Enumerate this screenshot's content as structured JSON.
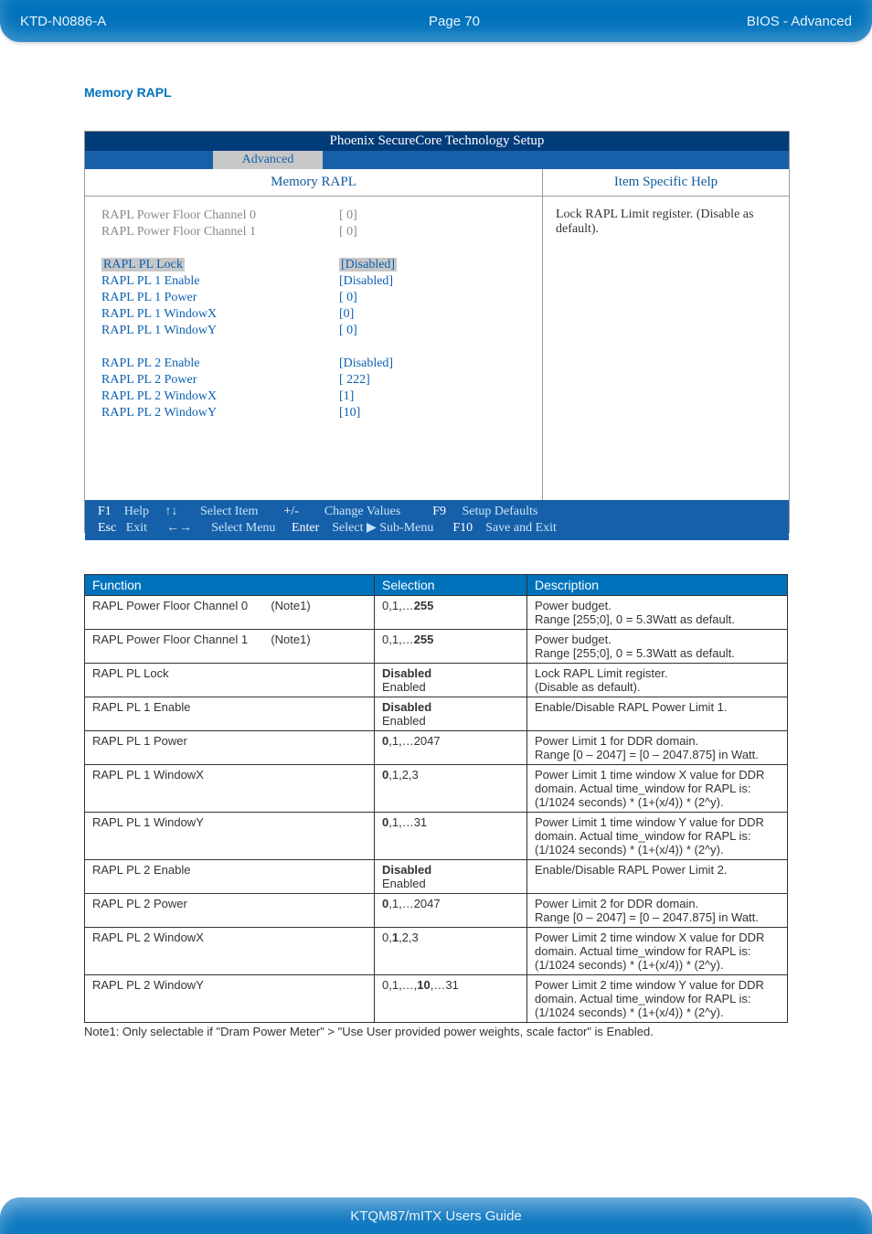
{
  "header": {
    "doc_id": "KTD-N0886-A",
    "page": "Page 70",
    "section": "BIOS  - Advanced"
  },
  "section_title": "Memory RAPL",
  "bios": {
    "title": "Phoenix SecureCore Technology Setup",
    "tab": "Advanced",
    "left_title": "Memory RAPL",
    "right_title": "Item Specific Help",
    "items": [
      {
        "label": "RAPL Power Floor Channel 0",
        "value": "[    0]",
        "dim": true
      },
      {
        "label": "RAPL Power Floor Channel 1",
        "value": "[    0]",
        "dim": true
      },
      {
        "spacer": true
      },
      {
        "label": "RAPL PL Lock",
        "value": "[Disabled]",
        "sel": true
      },
      {
        "label": "RAPL PL 1 Enable",
        "value": "[Disabled]"
      },
      {
        "label": "RAPL PL 1 Power",
        "value": "[    0]"
      },
      {
        "label": "RAPL PL 1 WindowX",
        "value": "[0]"
      },
      {
        "label": "RAPL PL 1 WindowY",
        "value": "[  0]"
      },
      {
        "spacer": true
      },
      {
        "label": "RAPL PL 2 Enable",
        "value": "[Disabled]"
      },
      {
        "label": "RAPL PL 2 Power",
        "value": "[  222]"
      },
      {
        "label": "RAPL PL 2 WindowX",
        "value": "[1]"
      },
      {
        "label": "RAPL PL 2 WindowY",
        "value": "[10]"
      }
    ],
    "help_text": "Lock RAPL Limit register. (Disable as default).",
    "footer": {
      "f1": "F1",
      "help": "Help",
      "ud": "↑↓",
      "si": "Select Item",
      "pm": "+/-",
      "cv": "Change Values",
      "f9": "F9",
      "sd": "Setup Defaults",
      "esc": "Esc",
      "exit": "Exit",
      "lr": "←→",
      "sm": "Select Menu",
      "enter": "Enter",
      "ssm": "Select ▶ Sub-Menu",
      "f10": "F10",
      "se": "Save and Exit"
    }
  },
  "table": {
    "headers": [
      "Function",
      "Selection",
      "Description"
    ],
    "rows": [
      {
        "f": "RAPL Power Floor Channel 0       (Note1)",
        "s": "0,1,…<b>255</b>",
        "d": "Power budget.<br>Range [255;0], 0 = 5.3Watt as default."
      },
      {
        "f": "RAPL Power Floor Channel 1       (Note1)",
        "s": "0,1,…<b>255</b>",
        "d": "Power budget.<br>Range [255;0], 0 = 5.3Watt as default."
      },
      {
        "f": "RAPL PL Lock",
        "s": "<b>Disabled</b><br>Enabled",
        "d": "Lock RAPL Limit register.<br>(Disable as default)."
      },
      {
        "f": "RAPL PL 1 Enable",
        "s": "<b>Disabled</b><br>Enabled",
        "d": "Enable/Disable RAPL Power Limit 1."
      },
      {
        "f": "RAPL PL 1 Power",
        "s": "<b>0</b>,1,…2047",
        "d": "Power Limit 1 for DDR domain.<br>Range [0 – 2047] = [0 – 2047.875] in Watt."
      },
      {
        "f": "RAPL PL 1 WindowX",
        "s": "<b>0</b>,1,2,3",
        "d": "Power Limit 1 time window X value for DDR domain. Actual time_window for RAPL is: (1/1024 seconds) * (1+(x/4)) * (2^y)."
      },
      {
        "f": "RAPL PL 1 WindowY",
        "s": "<b>0</b>,1,…31",
        "d": "Power Limit 1 time window Y value for DDR domain. Actual time_window for RAPL is: (1/1024 seconds) * (1+(x/4)) * (2^y)."
      },
      {
        "f": "RAPL PL 2 Enable",
        "s": "<b>Disabled</b><br>Enabled",
        "d": "Enable/Disable RAPL Power Limit 2."
      },
      {
        "f": "RAPL PL 2 Power",
        "s": "<b>0</b>,1,…2047",
        "d": "Power Limit 2 for DDR domain.<br>Range [0 – 2047] = [0 – 2047.875] in Watt."
      },
      {
        "f": "RAPL PL 2 WindowX",
        "s": "0,<b>1</b>,2,3",
        "d": "Power Limit 2 time window X value for DDR domain. Actual time_window for RAPL is: (1/1024 seconds) * (1+(x/4)) * (2^y)."
      },
      {
        "f": "RAPL PL 2 WindowY",
        "s": "0,1,…,<b>10</b>,…31",
        "d": "Power Limit 2 time window Y value for DDR domain. Actual time_window for RAPL is: (1/1024 seconds) * (1+(x/4)) * (2^y)."
      }
    ]
  },
  "note": "Note1: Only selectable if \"Dram Power Meter\" > \"Use User provided power weights, scale factor\" is Enabled.",
  "footer": "KTQM87/mITX Users Guide"
}
